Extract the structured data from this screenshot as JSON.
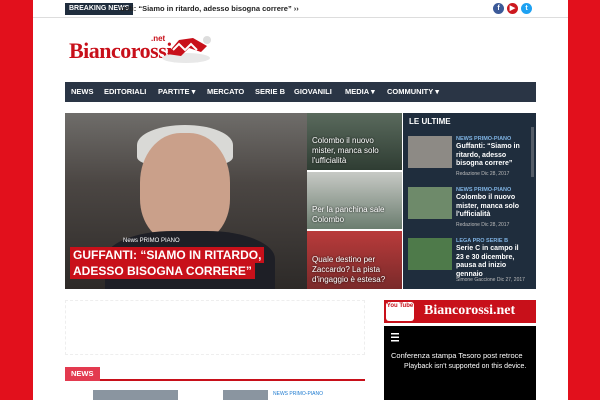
{
  "topbar": {
    "breaking_label": "BREAKING NEWS",
    "breaking_text": "unti: “Siamo in ritardo, adesso bisogna correre” ›› Col",
    "social": [
      {
        "icon": "facebook-icon",
        "glyph": "f",
        "color": "#3b5998"
      },
      {
        "icon": "youtube-icon",
        "glyph": "▶",
        "color": "#cc181e"
      },
      {
        "icon": "twitter-icon",
        "glyph": "t",
        "color": "#1da1f2"
      }
    ]
  },
  "logo": {
    "text": "Biancorossi",
    "suffix": ".net"
  },
  "nav": {
    "items": [
      "NEWS",
      "EDITORIALI",
      "PARTITE ▾",
      "MERCATO",
      "SERIE B",
      "GIOVANILI",
      "MEDIA ▾",
      "COMMUNITY ▾"
    ]
  },
  "hero": {
    "tag": "News  PRIMO PIANO",
    "title": "GUFFANTI: “SIAMO IN RITARDO, ADESSO BISOGNA CORRERE”"
  },
  "minis": [
    {
      "caption": "Colombo il nuovo mister, manca solo l'ufficialità"
    },
    {
      "caption": "Per la panchina sale Colombo"
    },
    {
      "caption": "Quale destino per Zaccardo? La pista d'ingaggio è estesa?"
    }
  ],
  "sidebar": {
    "title": "LE ULTIME",
    "items": [
      {
        "category": "NEWS  PRIMO-PIANO",
        "title": "Guffanti: “Siamo in ritardo, adesso bisogna correre”",
        "date": "Redazione  Dic 28, 2017"
      },
      {
        "category": "NEWS  PRIMO-PIANO",
        "title": "Colombo il nuovo mister, manca solo l'ufficialità",
        "date": "Redazione  Dic 28, 2017"
      },
      {
        "category": "LEGA PRO  SERIE B",
        "title": "Serie C in campo il 23 e 30 dicembre, pausa ad inizio gennaio",
        "date": "Simone Gaccione  Dic 27, 2017"
      }
    ]
  },
  "news_section": {
    "label": "NEWS"
  },
  "youtube": {
    "logo": "You Tube",
    "channel": "Biancorossi.net"
  },
  "video": {
    "title": "Conferenza stampa Tesoro post retroce",
    "message": "Playback isn't supported on this device."
  },
  "bottom": {
    "category": "NEWS  PRIMO-PIANO"
  }
}
